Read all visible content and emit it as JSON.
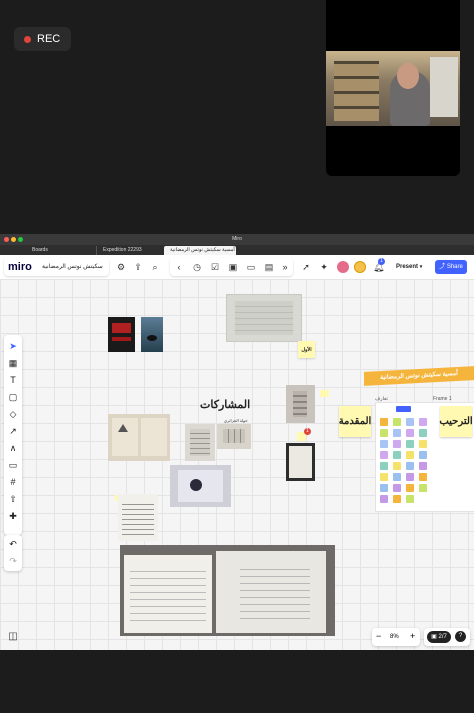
{
  "recording": {
    "label": "REC"
  },
  "window": {
    "title": "Miro"
  },
  "tabs": [
    {
      "label": "Boards"
    },
    {
      "label": "Expedition 22293"
    },
    {
      "label": "أمسية سكيتش نوتس الرمضانية"
    }
  ],
  "toolbar": {
    "logo": "miro",
    "board_name": "سكيتش نوتس الرمضانية",
    "present_label": "Present",
    "share_label": "Share",
    "notification_count": "1"
  },
  "canvas": {
    "participants_title": "المشاركات",
    "participant_caption": "خولة الجزائري",
    "sticky_yellow_small": "الأول",
    "sticky_intro": "المقدمة",
    "sticky_welcome": "الترحيب",
    "banner_text": "أمسية سكيتش نوتس الرمضانية",
    "frame_label": "Frame 1",
    "frame_side_label": "تعارف",
    "badge_count": "1"
  },
  "zoom": {
    "level": "8%"
  },
  "pages": {
    "indicator": "2/7"
  },
  "colors": {
    "accent": "#4262ff",
    "sticky_yellow": "#fff9b1",
    "banner_orange": "#f5b43c",
    "rec_dot": "#e0453a"
  }
}
